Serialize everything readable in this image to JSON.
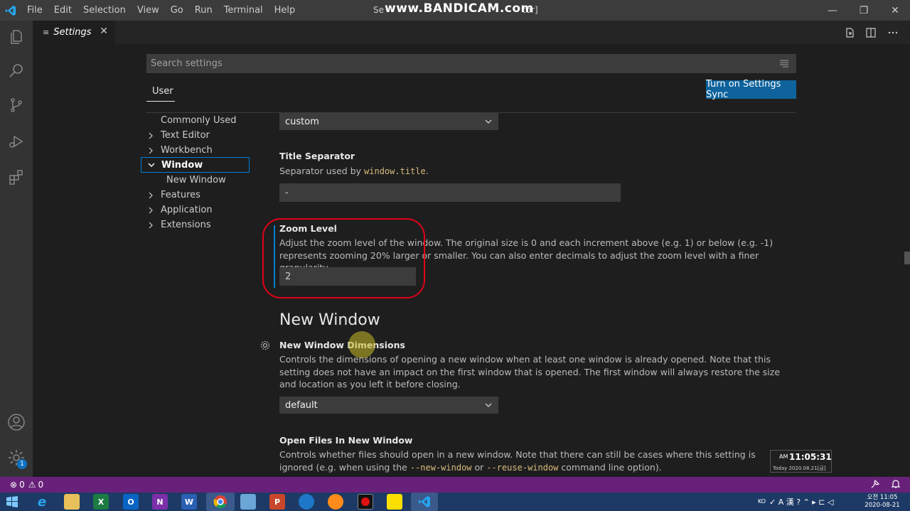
{
  "titlebar": {
    "menus": [
      "File",
      "Edit",
      "Selection",
      "View",
      "Go",
      "Run",
      "Terminal",
      "Help"
    ],
    "window_title_left": "Se",
    "window_title_right": "tor]",
    "watermark": "www.BANDICAM.com",
    "minimize": "—",
    "maximize": "❐",
    "close": "✕"
  },
  "tab": {
    "label": "Settings",
    "close": "✕"
  },
  "search": {
    "placeholder": "Search settings"
  },
  "scope": {
    "user_tab": "User",
    "sync_button": "Turn on Settings Sync"
  },
  "toc": {
    "items": [
      {
        "label": "Commonly Used"
      },
      {
        "label": "Text Editor"
      },
      {
        "label": "Workbench"
      },
      {
        "label": "Window"
      },
      {
        "label": "New Window"
      },
      {
        "label": "Features"
      },
      {
        "label": "Application"
      },
      {
        "label": "Extensions"
      }
    ]
  },
  "settings": {
    "title_bar_style_value": "custom",
    "title_separator": {
      "title": "Title Separator",
      "desc_prefix": "Separator used by ",
      "desc_code": "window.title",
      "desc_suffix": ".",
      "value": "-"
    },
    "zoom_level": {
      "title": "Zoom Level",
      "desc": "Adjust the zoom level of the window. The original size is 0 and each increment above (e.g. 1) or below (e.g. -1) represents zooming 20% larger or smaller. You can also enter decimals to adjust the zoom level with a finer granularity.",
      "value": "2"
    },
    "new_window_section": "New Window",
    "new_window_dimensions": {
      "title": "New Window Dimensions",
      "desc": "Controls the dimensions of opening a new window when at least one window is already opened. Note that this setting does not have an impact on the first window that is opened. The first window will always restore the size and location as you left it before closing.",
      "value": "default"
    },
    "open_files_in_new_window": {
      "title": "Open Files In New Window",
      "desc_prefix": "Controls whether files should open in a new window. Note that there can still be cases where this setting is ignored (e.g. when using the ",
      "desc_code1": "--new-window",
      "desc_mid": " or ",
      "desc_code2": "--reuse-window",
      "desc_suffix": " command line option)."
    }
  },
  "statusbar": {
    "errors": "0",
    "warnings": "0"
  },
  "accounts_badge": "1",
  "clock": {
    "ampm": "AM",
    "time": "11:05:31",
    "date": "Today 2020.08.21[금]"
  },
  "taskbar": {
    "tray_time": "오전 11:05",
    "tray_date": "2020-08-21",
    "ime_label": "KO"
  },
  "colors": {
    "statusbar": "#68217a",
    "sync_button": "#0e639c",
    "highlight_circle": "#e0001a",
    "focus": "#007fd4"
  }
}
